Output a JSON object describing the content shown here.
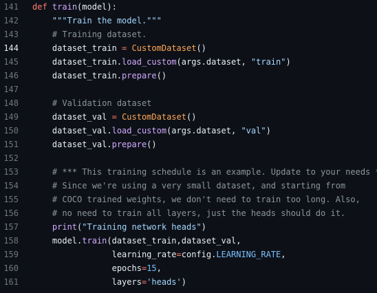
{
  "lines": [
    {
      "n": "141",
      "tokens": [
        [
          "kw",
          "def"
        ],
        [
          "pl",
          " "
        ],
        [
          "fn",
          "train"
        ],
        [
          "pl",
          "(model):"
        ]
      ]
    },
    {
      "n": "142",
      "tokens": [
        [
          "pl",
          "    "
        ],
        [
          "str",
          "\"\"\"Train the model.\"\"\""
        ]
      ]
    },
    {
      "n": "143",
      "tokens": [
        [
          "pl",
          "    "
        ],
        [
          "cm",
          "# Training dataset."
        ]
      ]
    },
    {
      "n": "144",
      "active": true,
      "tokens": [
        [
          "pl",
          "    dataset_train "
        ],
        [
          "op",
          "="
        ],
        [
          "pl",
          " "
        ],
        [
          "cls",
          "CustomDataset"
        ],
        [
          "pl",
          "()"
        ]
      ]
    },
    {
      "n": "145",
      "tokens": [
        [
          "pl",
          "    dataset_train."
        ],
        [
          "fn",
          "load_custom"
        ],
        [
          "pl",
          "(args.dataset, "
        ],
        [
          "str",
          "\"train\""
        ],
        [
          "pl",
          ")"
        ]
      ]
    },
    {
      "n": "146",
      "tokens": [
        [
          "pl",
          "    dataset_train."
        ],
        [
          "fn",
          "prepare"
        ],
        [
          "pl",
          "()"
        ]
      ]
    },
    {
      "n": "147",
      "tokens": []
    },
    {
      "n": "148",
      "tokens": [
        [
          "pl",
          "    "
        ],
        [
          "cm",
          "# Validation dataset"
        ]
      ]
    },
    {
      "n": "149",
      "tokens": [
        [
          "pl",
          "    dataset_val "
        ],
        [
          "op",
          "="
        ],
        [
          "pl",
          " "
        ],
        [
          "cls",
          "CustomDataset"
        ],
        [
          "pl",
          "()"
        ]
      ]
    },
    {
      "n": "150",
      "tokens": [
        [
          "pl",
          "    dataset_val."
        ],
        [
          "fn",
          "load_custom"
        ],
        [
          "pl",
          "(args.dataset, "
        ],
        [
          "str",
          "\"val\""
        ],
        [
          "pl",
          ")"
        ]
      ]
    },
    {
      "n": "151",
      "tokens": [
        [
          "pl",
          "    dataset_val."
        ],
        [
          "fn",
          "prepare"
        ],
        [
          "pl",
          "()"
        ]
      ]
    },
    {
      "n": "152",
      "tokens": []
    },
    {
      "n": "153",
      "tokens": [
        [
          "pl",
          "    "
        ],
        [
          "cm",
          "# *** This training schedule is an example. Update to your needs ***"
        ]
      ]
    },
    {
      "n": "154",
      "tokens": [
        [
          "pl",
          "    "
        ],
        [
          "cm",
          "# Since we're using a very small dataset, and starting from"
        ]
      ]
    },
    {
      "n": "155",
      "tokens": [
        [
          "pl",
          "    "
        ],
        [
          "cm",
          "# COCO trained weights, we don't need to train too long. Also,"
        ]
      ]
    },
    {
      "n": "156",
      "tokens": [
        [
          "pl",
          "    "
        ],
        [
          "cm",
          "# no need to train all layers, just the heads should do it."
        ]
      ]
    },
    {
      "n": "157",
      "tokens": [
        [
          "pl",
          "    "
        ],
        [
          "fn",
          "print"
        ],
        [
          "pl",
          "("
        ],
        [
          "str",
          "\"Training network heads\""
        ],
        [
          "pl",
          ")"
        ]
      ]
    },
    {
      "n": "158",
      "tokens": [
        [
          "pl",
          "    model."
        ],
        [
          "fn",
          "train"
        ],
        [
          "pl",
          "(dataset_train,dataset_val,"
        ]
      ]
    },
    {
      "n": "159",
      "tokens": [
        [
          "pl",
          "                learning_rate"
        ],
        [
          "op",
          "="
        ],
        [
          "pl",
          "config."
        ],
        [
          "const",
          "LEARNING_RATE"
        ],
        [
          "pl",
          ","
        ]
      ]
    },
    {
      "n": "160",
      "tokens": [
        [
          "pl",
          "                epochs"
        ],
        [
          "op",
          "="
        ],
        [
          "num",
          "15"
        ],
        [
          "pl",
          ","
        ]
      ]
    },
    {
      "n": "161",
      "tokens": [
        [
          "pl",
          "                layers"
        ],
        [
          "op",
          "="
        ],
        [
          "str",
          "'heads'"
        ],
        [
          "pl",
          ")"
        ]
      ]
    }
  ]
}
